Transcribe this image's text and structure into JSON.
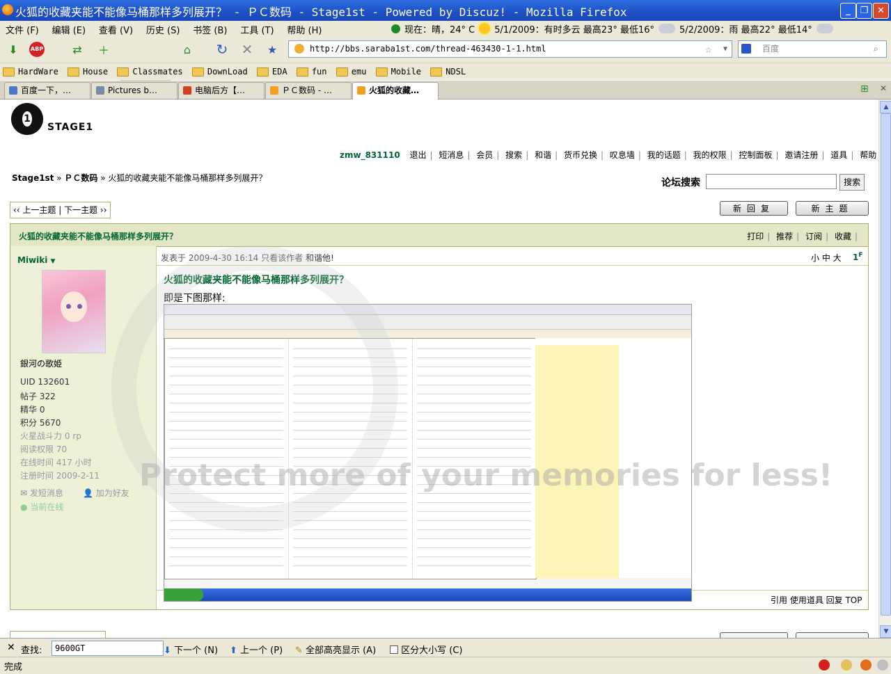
{
  "window": {
    "title": "火狐的收藏夹能不能像马桶那样多列展开？ - ＰＣ数码 - Stage1st - Powered by Discuz! - Mozilla Firefox"
  },
  "menu": [
    "文件 (F)",
    "编辑 (E)",
    "查看 (V)",
    "历史 (S)",
    "书签 (B)",
    "工具 (T)",
    "帮助 (H)"
  ],
  "weather": {
    "now": "现在：晴，24° C",
    "day1": "5/1/2009：有时多云 最高23° 最低16°",
    "day2": "5/2/2009：雨 最高22° 最低14°"
  },
  "address": {
    "url": "http://bbs.saraba1st.com/thread-463430-1-1.html",
    "search_placeholder": "百度"
  },
  "bookmarks": [
    "HardWare",
    "House",
    "Classmates",
    "DownLoad",
    "EDA",
    "fun",
    "emu",
    "Mobile",
    "NDSL"
  ],
  "tabs": [
    "百度一下，…",
    "Pictures b…",
    "电脑后方【…",
    "ＰＣ数码 - …",
    "火狐的收藏…"
  ],
  "forum": {
    "logo_text": "STAGE1",
    "user": "zmw_831110",
    "top_links": [
      "退出",
      "短消息",
      "会员",
      "搜索",
      "和谐",
      "货币兑换",
      "叹息墙",
      "我的话题",
      "我的权限",
      "控制面板",
      "邀请注册",
      "道具",
      "帮助"
    ],
    "breadcrumb": {
      "home": "Stage1st",
      "section": "ＰＣ数码",
      "thread": "火狐的收藏夹能不能像马桶那样多列展开？"
    },
    "search_label": "论坛搜索",
    "search_button": "搜索",
    "prev_next": "‹‹ 上一主题 | 下一主题 ››",
    "reply_button": "新回复",
    "new_topic_button": "新主题",
    "thread_title": "火狐的收藏夹能不能像马桶那样多列展开？",
    "thread_actions": [
      "打印",
      "推荐",
      "订阅",
      "收藏"
    ],
    "author": {
      "name": "Miwiki",
      "title": "銀河の歌姫",
      "stats": [
        {
          "label": "UID",
          "value": "132601"
        },
        {
          "label": "帖子",
          "value": "322"
        },
        {
          "label": "精华",
          "value": "0"
        },
        {
          "label": "积分",
          "value": "5670"
        }
      ],
      "dim_stats": [
        {
          "label": "火星战斗力",
          "value": "0 rp"
        },
        {
          "label": "阅读权限",
          "value": "70"
        },
        {
          "label": "在线时间",
          "value": "417 小时"
        },
        {
          "label": "注册时间",
          "value": "2009-2-11"
        }
      ],
      "send_msg": "发短消息",
      "add_friend": "加为好友",
      "online": "当前在线"
    },
    "post": {
      "meta_prefix": "发表于 2009-4-30 16:14",
      "meta_link1": "只看该作者",
      "meta_link2": "和谐他!",
      "font_sizes": "小 中 大",
      "floor": "1",
      "floor_sup": "F",
      "title": "火狐的收藏夹能不能像马桶那样多列展开？",
      "body": "即是下图那样:",
      "footer": "引用 使用道具 回复 TOP"
    },
    "watermark": "Protect more of your memories for less!"
  },
  "findbar": {
    "label": "查找:",
    "value": "9600GT",
    "next": "下一个 (N)",
    "prev": "上一个 (P)",
    "highlight": "全部高亮显示 (A)",
    "case": "区分大小写 (C)"
  },
  "status": {
    "text": "完成"
  },
  "colors": {
    "accent_green": "#063",
    "thread_head_bg": "#e3e6c7",
    "title_blue": "#1d4fc4"
  }
}
